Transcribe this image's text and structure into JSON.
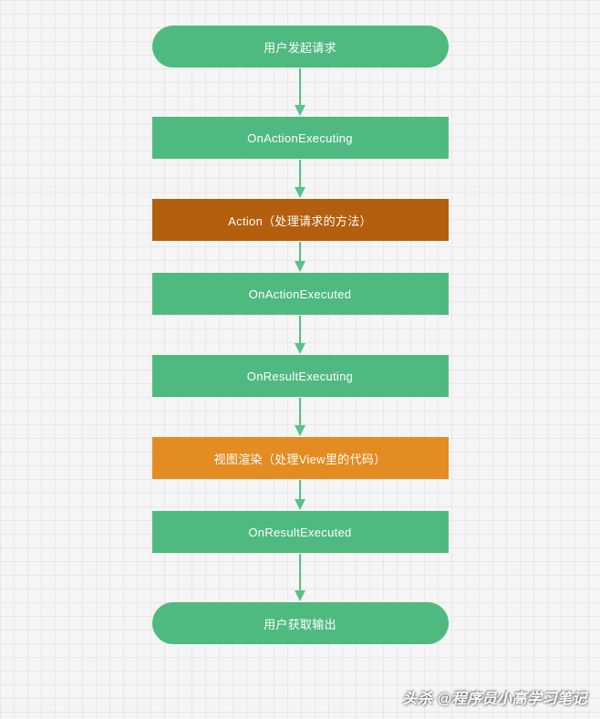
{
  "nodes": [
    {
      "label": "用户发起请求",
      "style": "green rounded",
      "arrow_after_h": 40
    },
    {
      "label": "OnActionExecuting",
      "style": "green",
      "arrow_after_h": 30
    },
    {
      "label": "Action（处理请求的方法）",
      "style": "brown",
      "arrow_after_h": 21
    },
    {
      "label": "OnActionExecuted",
      "style": "green",
      "arrow_after_h": 30
    },
    {
      "label": "OnResultExecuting",
      "style": "green",
      "arrow_after_h": 30
    },
    {
      "label": "视图渲染（处理View里的代码）",
      "style": "orange",
      "arrow_after_h": 21
    },
    {
      "label": "OnResultExecuted",
      "style": "green",
      "arrow_after_h": 40
    },
    {
      "label": "用户获取输出",
      "style": "green rounded",
      "arrow_after_h": null
    }
  ],
  "watermark": "头杀 @程序员小高学习笔记"
}
